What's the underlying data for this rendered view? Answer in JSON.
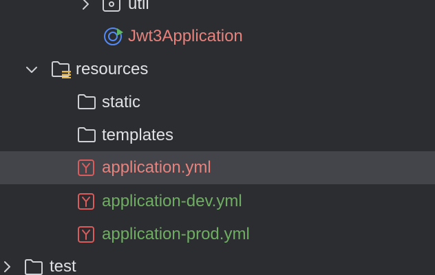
{
  "tree": {
    "items": [
      {
        "label": "util",
        "icon": "package-icon",
        "expanded": false
      },
      {
        "label": "Jwt3Application",
        "icon": "spring-boot-app-icon"
      },
      {
        "label": "resources",
        "icon": "resources-folder-icon",
        "expanded": true
      },
      {
        "label": "static",
        "icon": "folder-icon"
      },
      {
        "label": "templates",
        "icon": "folder-icon"
      },
      {
        "label": "application.yml",
        "icon": "yaml-file-icon",
        "selected": true
      },
      {
        "label": "application-dev.yml",
        "icon": "yaml-file-icon"
      },
      {
        "label": "application-prod.yml",
        "icon": "yaml-file-icon"
      },
      {
        "label": "test",
        "icon": "folder-icon",
        "expanded": false
      }
    ]
  },
  "colors": {
    "background": "#2b2d30",
    "selected_row": "#43454a",
    "text_default": "#dfe1e5",
    "text_modified": "#e8827d",
    "text_added": "#6fae62",
    "icon_gray": "#ced0d6",
    "yaml_icon_red": "#db5c5c",
    "spring_blue": "#548af7",
    "spring_green": "#5fb865",
    "resources_badge": "#e8b84a"
  }
}
